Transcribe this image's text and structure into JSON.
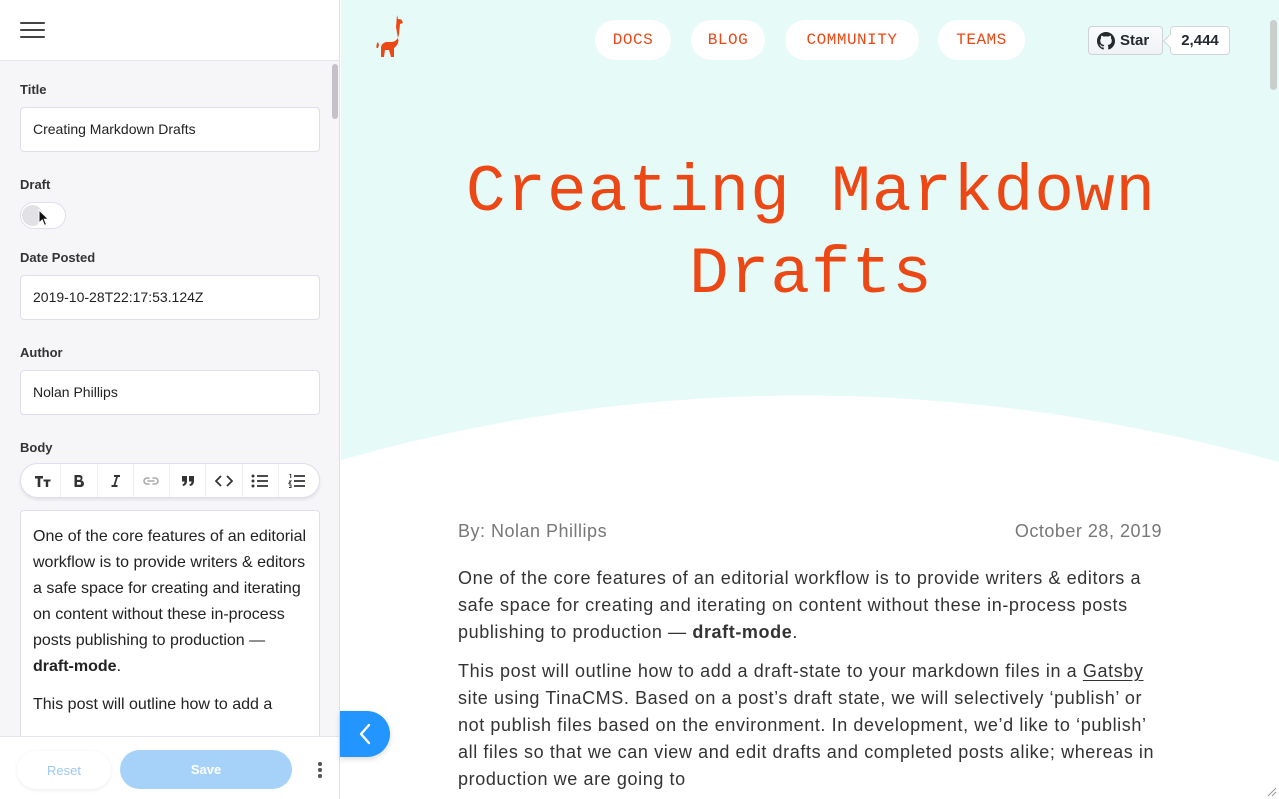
{
  "sidebar": {
    "fields": {
      "title": {
        "label": "Title",
        "value": "Creating Markdown Drafts"
      },
      "draft": {
        "label": "Draft",
        "checked": false
      },
      "date": {
        "label": "Date Posted",
        "value": "2019-10-28T22:17:53.124Z"
      },
      "author": {
        "label": "Author",
        "value": "Nolan Phillips"
      },
      "body": {
        "label": "Body",
        "toolbar": [
          "heading-icon",
          "bold-icon",
          "italic-icon",
          "link-icon",
          "quote-icon",
          "code-icon",
          "bullet-list-icon",
          "ordered-list-icon"
        ],
        "p1_text": "One of the core features of an editorial workflow is to provide writers & editors a safe space for creating and iterating on content without these in-process posts publishing to production — ",
        "p1_bold": "draft-mode",
        "p1_end": ".",
        "p2_text": "This post will outline how to add a"
      }
    },
    "footer": {
      "reset_label": "Reset",
      "save_label": "Save"
    }
  },
  "site": {
    "nav": [
      "DOCS",
      "BLOG",
      "COMMUNITY",
      "TEAMS"
    ],
    "github": {
      "star_label": "Star",
      "count": "2,444"
    },
    "hero_title": "Creating Markdown Drafts",
    "author_line": "By: Nolan Phillips",
    "date": "October 28, 2019",
    "p1_text": "One of the core features of an editorial workflow is to provide writers & editors a safe space for creating and iterating on content without these in-process posts publishing to production — ",
    "p1_bold": "draft-mode",
    "p1_end": ".",
    "p2_pre": "This post will outline how to add a draft-state to your markdown files in a ",
    "p2_link": "Gatsby",
    "p2_post": " site using TinaCMS. Based on a post’s draft state, we will selectively ‘publish’ or not publish files based on the environment. In development, we’d like to ‘publish’ all files so that we can view and edit drafts and completed posts alike; whereas in production we are going to"
  },
  "colors": {
    "brand": "#ec4815",
    "hero_bg": "#e6faf8",
    "accent_blue": "#2296fe",
    "save_disabled": "#a6d2fa"
  }
}
